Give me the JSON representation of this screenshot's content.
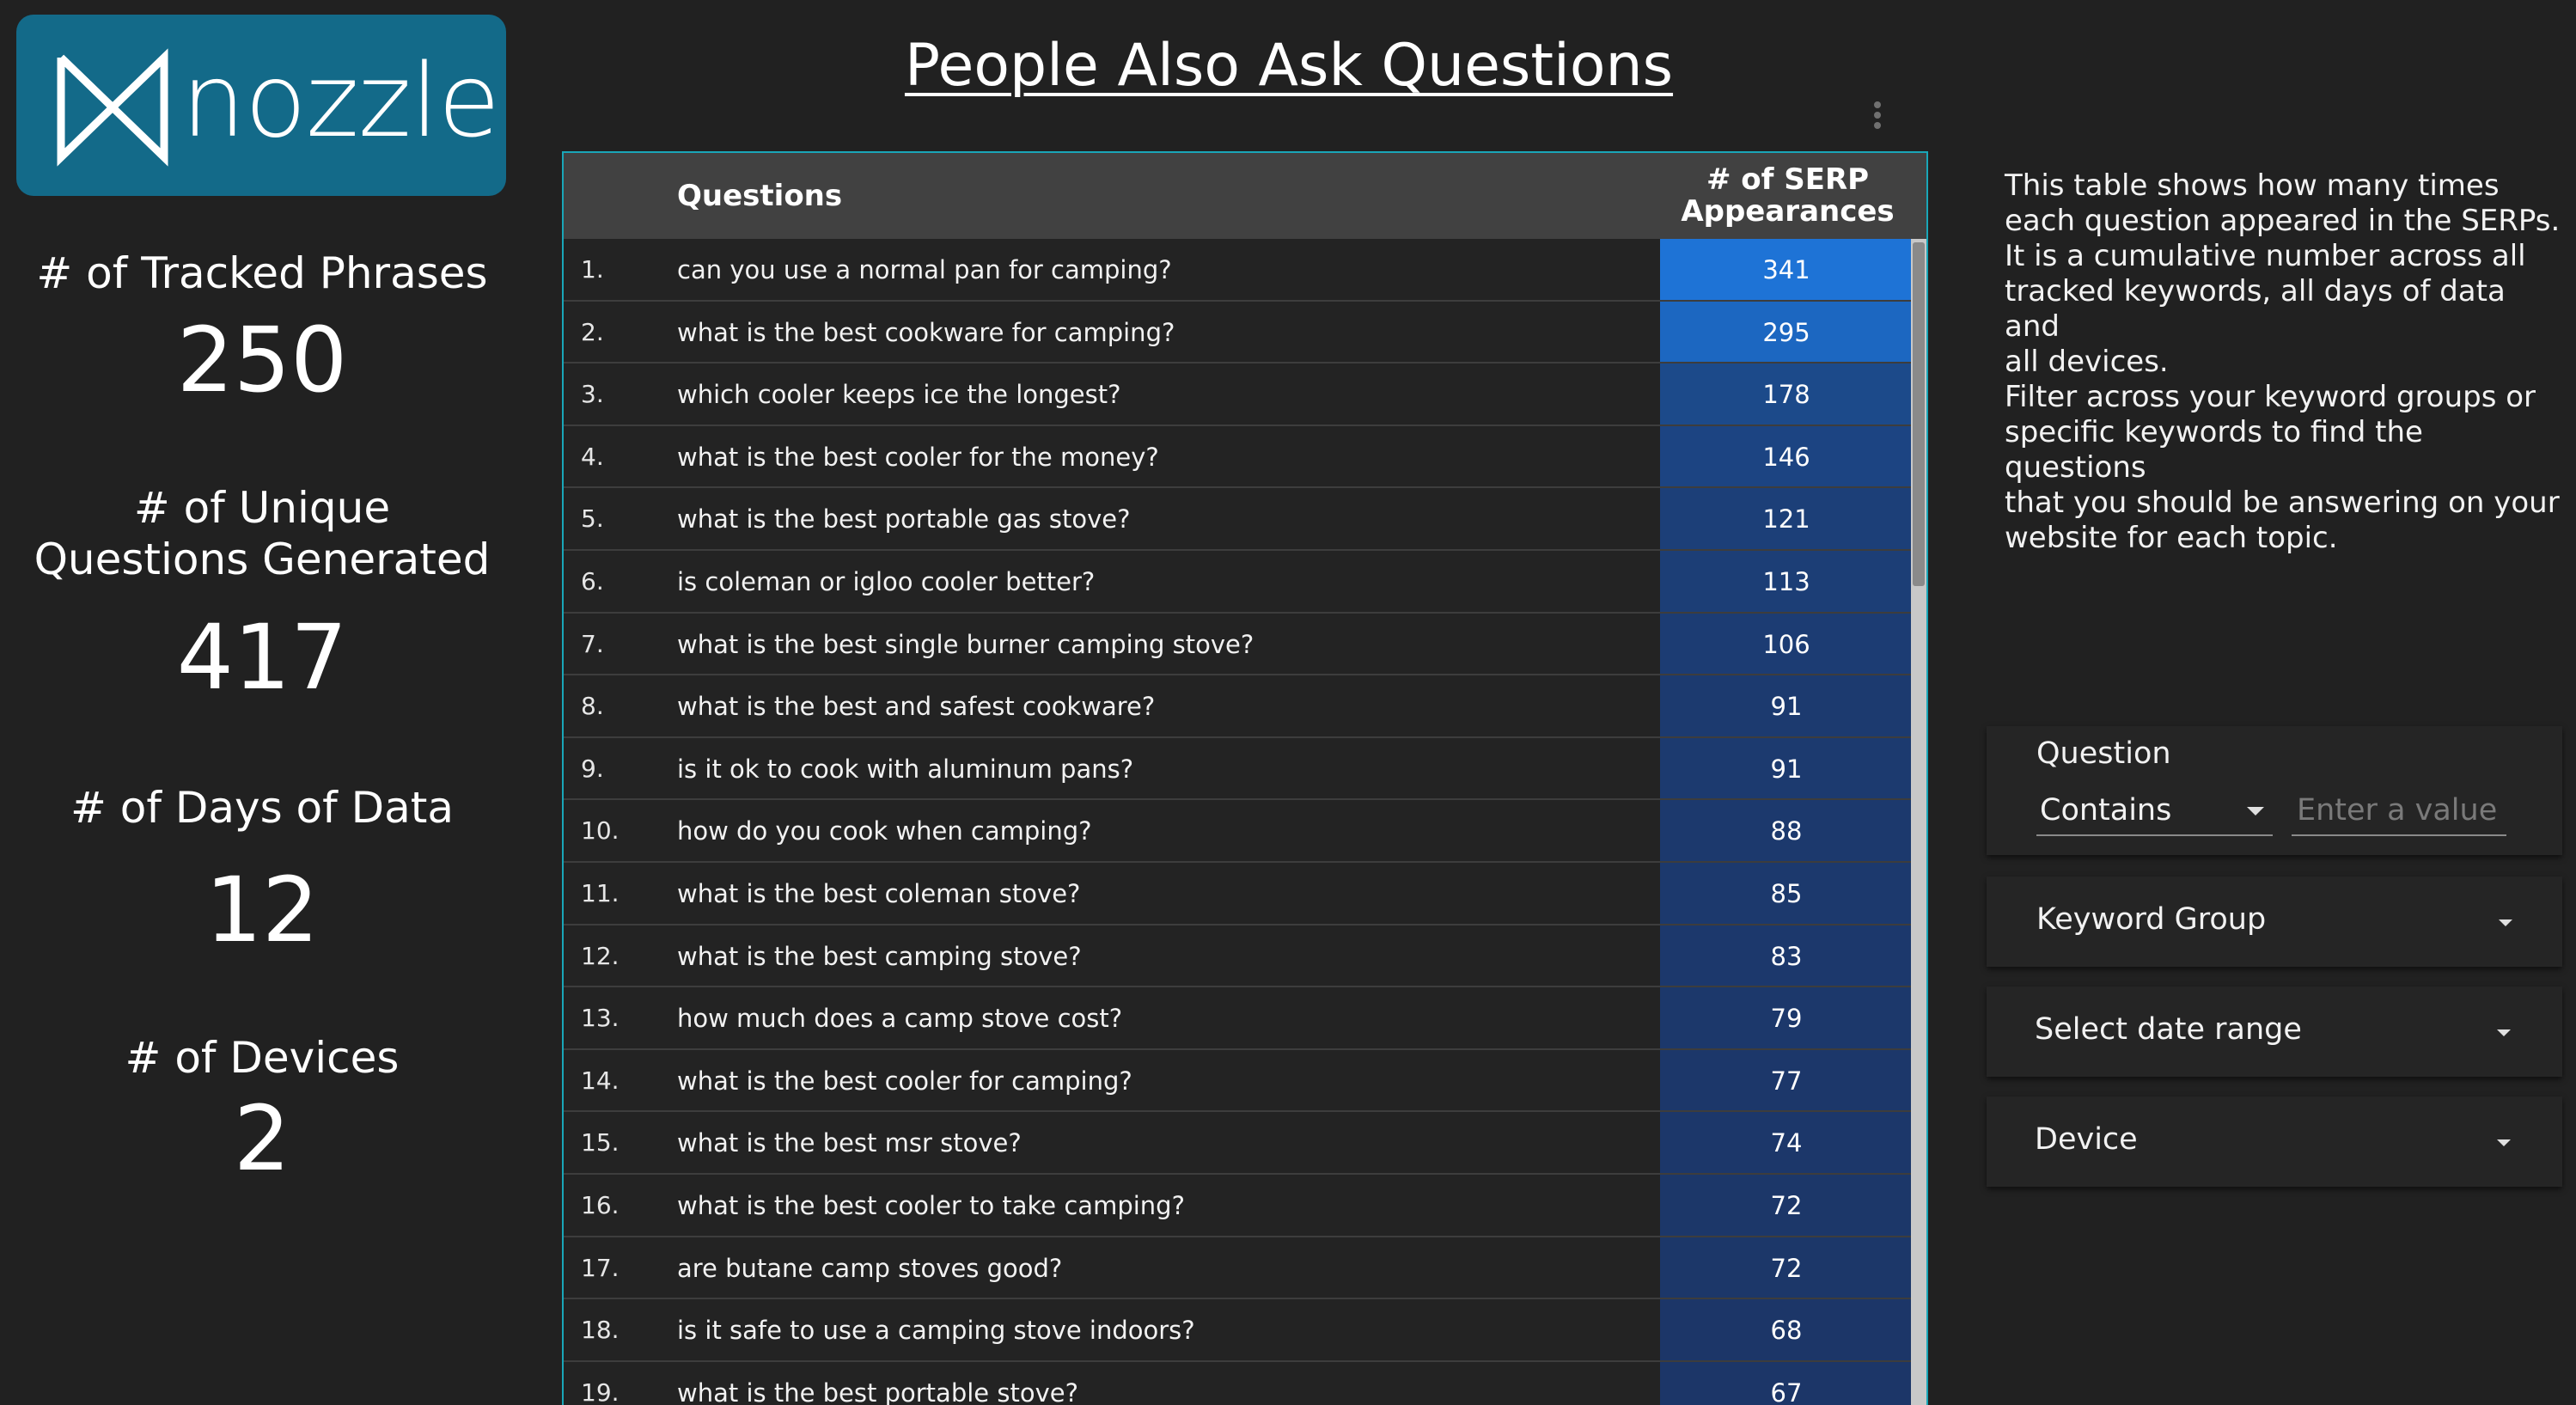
{
  "logo": {
    "text": "nozzle"
  },
  "stats": [
    {
      "label": "# of Tracked Phrases",
      "value": "250"
    },
    {
      "label_line1": "# of Unique",
      "label_line2": "Questions Generated",
      "value": "417"
    },
    {
      "label": "# of Days of Data",
      "value": "12"
    },
    {
      "label": "# of Devices",
      "value": "2"
    }
  ],
  "title": "People Also Ask Questions",
  "table": {
    "headers": {
      "questions": "Questions",
      "count_line1": "# of SERP",
      "count_line2": "Appearances"
    },
    "rows": [
      {
        "num": "1.",
        "question": "can you use a normal pan for camping?",
        "count": "341",
        "color": "#1e73d6"
      },
      {
        "num": "2.",
        "question": "what is the best cookware for camping?",
        "count": "295",
        "color": "#1c67c1"
      },
      {
        "num": "3.",
        "question": "which cooler keeps ice the longest?",
        "count": "178",
        "color": "#1c4a8a"
      },
      {
        "num": "4.",
        "question": "what is the best cooler for the money?",
        "count": "146",
        "color": "#1c4482"
      },
      {
        "num": "5.",
        "question": "what is the best portable gas stove?",
        "count": "121",
        "color": "#1c3f78"
      },
      {
        "num": "6.",
        "question": "is coleman or igloo cooler better?",
        "count": "113",
        "color": "#1c3e76"
      },
      {
        "num": "7.",
        "question": "what is the best single burner camping stove?",
        "count": "106",
        "color": "#1c3c73"
      },
      {
        "num": "8.",
        "question": "what is the best and safest cookware?",
        "count": "91",
        "color": "#1c3a6f"
      },
      {
        "num": "9.",
        "question": "is it ok to cook with aluminum pans?",
        "count": "91",
        "color": "#1c3a6f"
      },
      {
        "num": "10.",
        "question": "how do you cook when camping?",
        "count": "88",
        "color": "#1c396d"
      },
      {
        "num": "11.",
        "question": "what is the best coleman stove?",
        "count": "85",
        "color": "#1c396d"
      },
      {
        "num": "12.",
        "question": "what is the best camping stove?",
        "count": "83",
        "color": "#1c386c"
      },
      {
        "num": "13.",
        "question": "how much does a camp stove cost?",
        "count": "79",
        "color": "#1c386b"
      },
      {
        "num": "14.",
        "question": "what is the best cooler for camping?",
        "count": "77",
        "color": "#1c376a"
      },
      {
        "num": "15.",
        "question": "what is the best msr stove?",
        "count": "74",
        "color": "#1c376a"
      },
      {
        "num": "16.",
        "question": "what is the best cooler to take camping?",
        "count": "72",
        "color": "#1c3769"
      },
      {
        "num": "17.",
        "question": "are butane camp stoves good?",
        "count": "72",
        "color": "#1c3769"
      },
      {
        "num": "18.",
        "question": "is it safe to use a camping stove indoors?",
        "count": "68",
        "color": "#1c3668"
      },
      {
        "num": "19.",
        "question": "what is the best portable stove?",
        "count": "67",
        "color": "#1c3668"
      }
    ]
  },
  "description": {
    "p1_lines": [
      "This table shows how many times",
      "each question appeared in the SERPs.",
      "It is a cumulative number across all",
      "tracked keywords, all days of data and",
      "all devices."
    ],
    "p2_lines": [
      "Filter across your keyword groups or",
      "specific keywords to find the questions",
      "that you should be answering on your",
      "website for each topic."
    ]
  },
  "filters": {
    "question_label": "Question",
    "question_operator": "Contains",
    "question_placeholder": "Enter a value",
    "keyword_group": "Keyword Group",
    "date_range": "Select date range",
    "device": "Device"
  },
  "colors": {
    "background": "#212121",
    "logo_bg": "#136a89",
    "table_border": "#19a6b8",
    "header_bg": "#414141"
  }
}
